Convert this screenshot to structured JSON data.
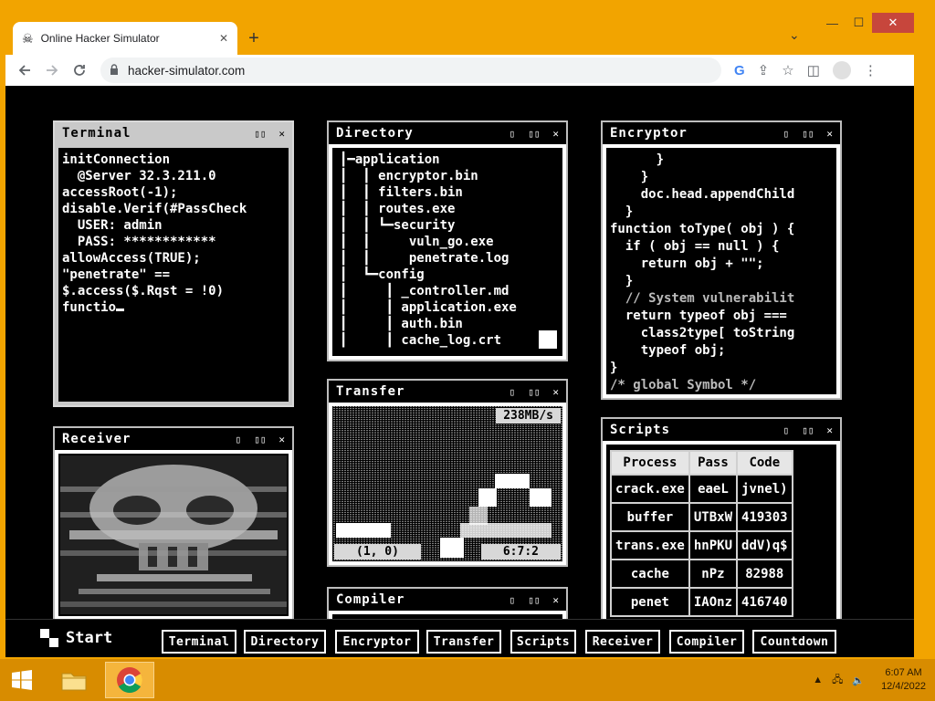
{
  "browser": {
    "tab_title": "Online Hacker Simulator",
    "url": "hacker-simulator.com",
    "new_tab": "+",
    "tab_close": "✕"
  },
  "terminal": {
    "title": "Terminal",
    "lines": [
      "initConnection",
      "  @Server 32.3.211.0",
      "accessRoot(-1);",
      "disable.Verif(#PassCheck",
      "  USER: admin",
      "  PASS: ************",
      "allowAccess(TRUE);",
      "\"penetrate\" ==",
      "$.access($.Rqst = !0)",
      "functio"
    ]
  },
  "directory": {
    "title": "Directory",
    "lines": [
      "┃━application",
      "┃  ┃ encryptor.bin",
      "┃  ┃ filters.bin",
      "┃  ┃ routes.exe",
      "┃  ┃ ┗━security",
      "┃  ┃     vuln_go.exe",
      "┃  ┃     penetrate.log",
      "┃  ┗━config",
      "┃     ┃ _controller.md",
      "┃     ┃ application.exe",
      "┃     ┃ auth.bin",
      "┃     ┃ cache_log.crt"
    ]
  },
  "encryptor": {
    "title": "Encryptor",
    "lines": [
      "      }",
      "    }",
      "    doc.head.appendChild",
      "  }",
      "function toType( obj ) {",
      "  if ( obj == null ) {",
      "    return obj + \"\";",
      "  }",
      "  // System vulnerabilit",
      "  return typeof obj ===",
      "    class2type[ toString",
      "    typeof obj;",
      "}",
      "/* global Symbol */"
    ]
  },
  "transfer": {
    "title": "Transfer",
    "rate": "238MB/s",
    "coords": "(1, 0)",
    "ratio": "6:7:2"
  },
  "receiver": {
    "title": "Receiver"
  },
  "scripts": {
    "title": "Scripts",
    "headers": [
      "Process",
      "Pass",
      "Code"
    ],
    "rows": [
      [
        "crack.exe",
        "eaeL",
        "jvnel)"
      ],
      [
        "buffer",
        "UTBxW",
        "419303"
      ],
      [
        "trans.exe",
        "hnPKU",
        "ddV)q$"
      ],
      [
        "cache",
        "nPz",
        "82988"
      ],
      [
        "penet",
        "IAOnz",
        "416740"
      ]
    ]
  },
  "compiler": {
    "title": "Compiler"
  },
  "window_buttons": {
    "min": "▯",
    "max": "▯▯",
    "close": "✕"
  },
  "simbar": {
    "start": "Start",
    "buttons": [
      "Terminal",
      "Directory",
      "Encryptor",
      "Transfer",
      "Scripts",
      "Receiver",
      "Compiler",
      "Countdown"
    ]
  },
  "taskbar": {
    "time": "6:07 AM",
    "date": "12/4/2022"
  }
}
